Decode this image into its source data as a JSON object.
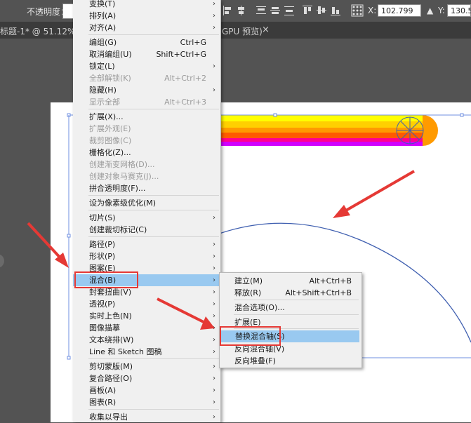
{
  "control_bar": {
    "opacity_label": "不透明度：",
    "x_label": "X:",
    "x_value": "102.799",
    "y_label": "Y:",
    "y_value": "130.5"
  },
  "tabs": {
    "left_fragment": "标题-1* @ 51.12% (RC",
    "right_fragment": "GPU 预览)",
    "close": "×"
  },
  "object_menu": {
    "items": [
      {
        "label": "变换(T)",
        "shortcut": "",
        "submenu": true,
        "disabled": false
      },
      {
        "label": "排列(A)",
        "shortcut": "",
        "submenu": true,
        "disabled": false
      },
      {
        "label": "对齐(A)",
        "shortcut": "",
        "submenu": true,
        "disabled": false
      },
      {
        "label": "编组(G)",
        "shortcut": "Ctrl+G",
        "submenu": false,
        "disabled": false
      },
      {
        "label": "取消编组(U)",
        "shortcut": "Shift+Ctrl+G",
        "submenu": false,
        "disabled": false
      },
      {
        "label": "锁定(L)",
        "shortcut": "",
        "submenu": true,
        "disabled": false
      },
      {
        "label": "全部解锁(K)",
        "shortcut": "Alt+Ctrl+2",
        "submenu": false,
        "disabled": true
      },
      {
        "label": "隐藏(H)",
        "shortcut": "",
        "submenu": true,
        "disabled": false
      },
      {
        "label": "显示全部",
        "shortcut": "Alt+Ctrl+3",
        "submenu": false,
        "disabled": true
      },
      {
        "label": "扩展(X)...",
        "shortcut": "",
        "submenu": false,
        "disabled": false
      },
      {
        "label": "扩展外观(E)",
        "shortcut": "",
        "submenu": false,
        "disabled": true
      },
      {
        "label": "裁剪图像(C)",
        "shortcut": "",
        "submenu": false,
        "disabled": true
      },
      {
        "label": "栅格化(Z)...",
        "shortcut": "",
        "submenu": false,
        "disabled": false
      },
      {
        "label": "创建渐变网格(D)...",
        "shortcut": "",
        "submenu": false,
        "disabled": true
      },
      {
        "label": "创建对象马赛克(J)...",
        "shortcut": "",
        "submenu": false,
        "disabled": true
      },
      {
        "label": "拼合透明度(F)...",
        "shortcut": "",
        "submenu": false,
        "disabled": false
      },
      {
        "label": "设为像素级优化(M)",
        "shortcut": "",
        "submenu": false,
        "disabled": false
      },
      {
        "label": "切片(S)",
        "shortcut": "",
        "submenu": true,
        "disabled": false
      },
      {
        "label": "创建裁切标记(C)",
        "shortcut": "",
        "submenu": false,
        "disabled": false
      },
      {
        "label": "路径(P)",
        "shortcut": "",
        "submenu": true,
        "disabled": false
      },
      {
        "label": "形状(P)",
        "shortcut": "",
        "submenu": true,
        "disabled": false
      },
      {
        "label": "图案(E)",
        "shortcut": "",
        "submenu": true,
        "disabled": false
      },
      {
        "label": "混合(B)",
        "shortcut": "",
        "submenu": true,
        "disabled": false
      },
      {
        "label": "封套扭曲(V)",
        "shortcut": "",
        "submenu": true,
        "disabled": false
      },
      {
        "label": "透视(P)",
        "shortcut": "",
        "submenu": true,
        "disabled": false
      },
      {
        "label": "实时上色(N)",
        "shortcut": "",
        "submenu": true,
        "disabled": false
      },
      {
        "label": "图像描摹",
        "shortcut": "",
        "submenu": true,
        "disabled": false
      },
      {
        "label": "文本绕排(W)",
        "shortcut": "",
        "submenu": true,
        "disabled": false
      },
      {
        "label": "Line 和 Sketch 图稿",
        "shortcut": "",
        "submenu": true,
        "disabled": false
      },
      {
        "label": "剪切蒙版(M)",
        "shortcut": "",
        "submenu": true,
        "disabled": false
      },
      {
        "label": "复合路径(O)",
        "shortcut": "",
        "submenu": true,
        "disabled": false
      },
      {
        "label": "画板(A)",
        "shortcut": "",
        "submenu": true,
        "disabled": false
      },
      {
        "label": "图表(R)",
        "shortcut": "",
        "submenu": true,
        "disabled": false
      },
      {
        "label": "收集以导出",
        "shortcut": "",
        "submenu": true,
        "disabled": false
      }
    ]
  },
  "blend_submenu": {
    "items": [
      {
        "label": "建立(M)",
        "shortcut": "Alt+Ctrl+B"
      },
      {
        "label": "释放(R)",
        "shortcut": "Alt+Shift+Ctrl+B"
      },
      {
        "label": "混合选项(O)...",
        "shortcut": ""
      },
      {
        "label": "扩展(E)",
        "shortcut": ""
      },
      {
        "label": "替换混合轴(S)",
        "shortcut": ""
      },
      {
        "label": "反向混合轴(V)",
        "shortcut": ""
      },
      {
        "label": "反向堆叠(F)",
        "shortcut": ""
      }
    ]
  },
  "colors": {
    "menu_highlight": "#99c9f0",
    "annotation_red": "#e53935",
    "path_blue": "#3f5fb0",
    "stripes": [
      "#ffff00",
      "#ffd000",
      "#ff9a00",
      "#ff5a00",
      "#ff0090",
      "#d000ff"
    ]
  },
  "arrow_submenu_glyph": "›"
}
